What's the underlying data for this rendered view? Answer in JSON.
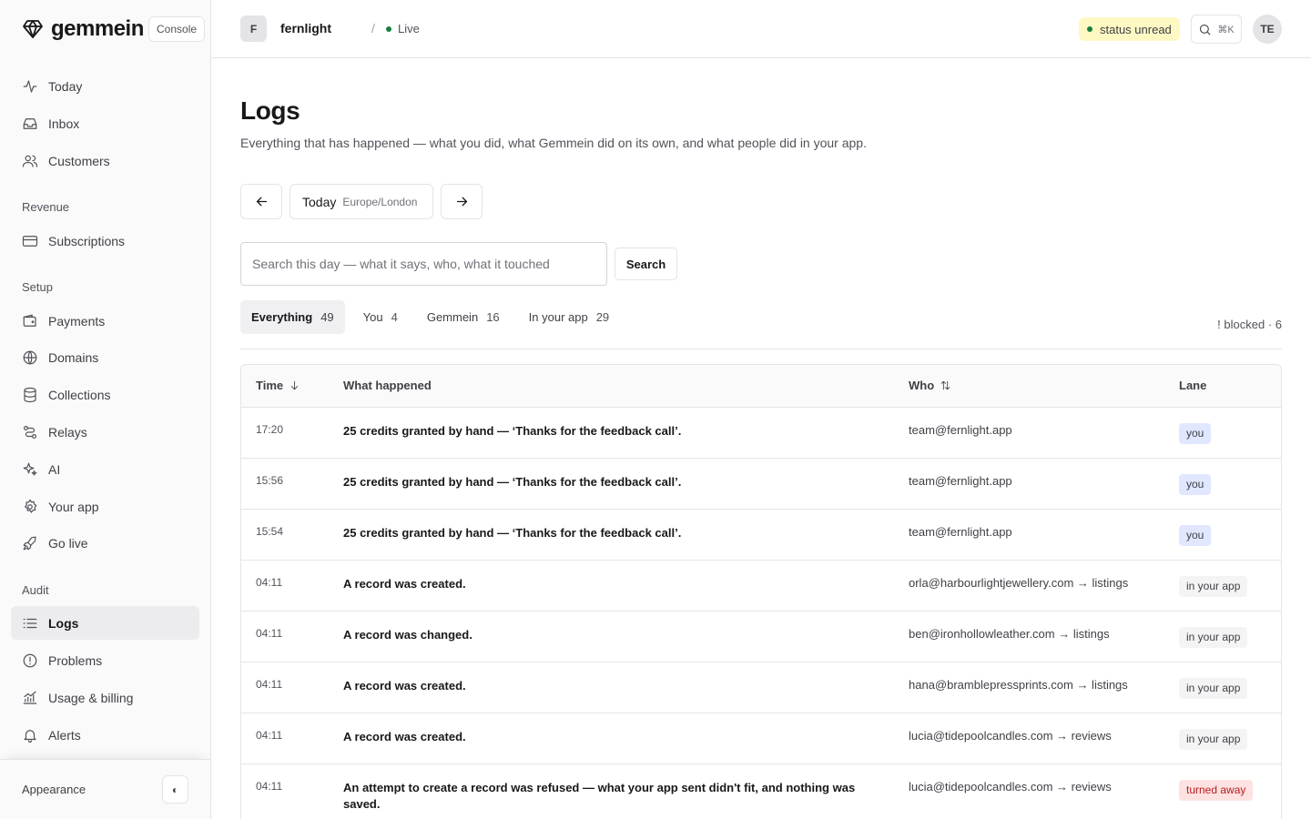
{
  "brand": {
    "name": "gemmein",
    "console_label": "Console"
  },
  "sidebar": {
    "main_items": [
      {
        "label": "Today",
        "icon": "activity-icon"
      },
      {
        "label": "Inbox",
        "icon": "inbox-icon"
      },
      {
        "label": "Customers",
        "icon": "users-icon"
      }
    ],
    "sections": [
      {
        "label": "Revenue",
        "items": [
          {
            "label": "Subscriptions",
            "icon": "credit-card-icon"
          }
        ]
      },
      {
        "label": "Setup",
        "items": [
          {
            "label": "Payments",
            "icon": "wallet-icon"
          },
          {
            "label": "Domains",
            "icon": "globe-icon"
          },
          {
            "label": "Collections",
            "icon": "database-icon"
          },
          {
            "label": "Relays",
            "icon": "route-icon"
          },
          {
            "label": "AI",
            "icon": "sparkles-icon"
          },
          {
            "label": "Your app",
            "icon": "gear-icon"
          },
          {
            "label": "Go live",
            "icon": "rocket-icon"
          }
        ]
      },
      {
        "label": "Audit",
        "items": [
          {
            "label": "Logs",
            "icon": "list-icon",
            "active": true
          },
          {
            "label": "Problems",
            "icon": "alert-circle-icon"
          },
          {
            "label": "Usage & billing",
            "icon": "chart-icon"
          },
          {
            "label": "Alerts",
            "icon": "bell-icon"
          }
        ]
      }
    ],
    "footer": {
      "appearance_label": "Appearance",
      "toggle_glyph": "◐"
    }
  },
  "topbar": {
    "app_initial": "F",
    "app_name": "fernlight",
    "separator": "/",
    "env_label": "Live",
    "status_label": "status unread",
    "search_shortcut": "⌘K",
    "user_initials": "TE"
  },
  "page": {
    "title": "Logs",
    "description": "Everything that has happened — what you did, what Gemmein did on its own, and what people did in your app.",
    "date": {
      "day": "Today",
      "timezone": "Europe/London"
    },
    "search": {
      "placeholder": "Search this day — what it says, who, what it touched",
      "value": "",
      "button_label": "Search"
    },
    "tabs": [
      {
        "label": "Everything",
        "count": "49",
        "active": true
      },
      {
        "label": "You",
        "count": "4"
      },
      {
        "label": "Gemmein",
        "count": "16"
      },
      {
        "label": "In your app",
        "count": "29"
      }
    ],
    "blocked_note": "! blocked · 6"
  },
  "table": {
    "headers": {
      "time": "Time",
      "what": "What happened",
      "who": "Who",
      "lane": "Lane"
    },
    "rows": [
      {
        "time": "17:20",
        "what": "25 credits granted by hand — ‘Thanks for the feedback call’.",
        "who": "team@fernlight.app",
        "lane": "you",
        "lane_kind": "you"
      },
      {
        "time": "15:56",
        "what": "25 credits granted by hand — ‘Thanks for the feedback call’.",
        "who": "team@fernlight.app",
        "lane": "you",
        "lane_kind": "you"
      },
      {
        "time": "15:54",
        "what": "25 credits granted by hand — ‘Thanks for the feedback call’.",
        "who": "team@fernlight.app",
        "lane": "you",
        "lane_kind": "you"
      },
      {
        "time": "04:11",
        "what": "A record was created.",
        "who": "orla@harbourlightjewellery.com → listings",
        "lane": "in your app",
        "lane_kind": "app"
      },
      {
        "time": "04:11",
        "what": "A record was changed.",
        "who": "ben@ironhollowleather.com → listings",
        "lane": "in your app",
        "lane_kind": "app"
      },
      {
        "time": "04:11",
        "what": "A record was created.",
        "who": "hana@bramblepressprints.com → listings",
        "lane": "in your app",
        "lane_kind": "app"
      },
      {
        "time": "04:11",
        "what": "A record was created.",
        "who": "lucia@tidepoolcandles.com → reviews",
        "lane": "in your app",
        "lane_kind": "app"
      },
      {
        "time": "04:11",
        "what": "An attempt to create a record was refused — what your app sent didn't fit, and nothing was saved.",
        "who": "lucia@tidepoolcandles.com → reviews",
        "lane": "turned away",
        "lane_kind": "away"
      }
    ]
  }
}
